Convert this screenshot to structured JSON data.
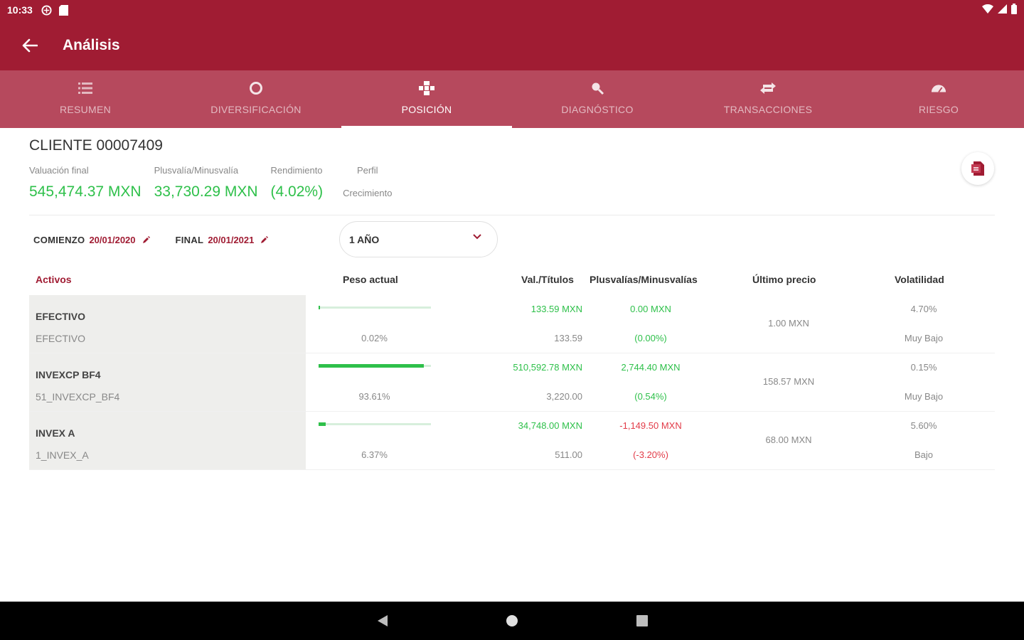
{
  "status_bar": {
    "time": "10:33"
  },
  "app_bar": {
    "title": "Análisis"
  },
  "tabs": [
    {
      "label": "RESUMEN",
      "icon": "list-icon"
    },
    {
      "label": "DIVERSIFICACIÓN",
      "icon": "donut-icon"
    },
    {
      "label": "POSICIÓN",
      "icon": "blocks-icon",
      "active": true
    },
    {
      "label": "DIAGNÓSTICO",
      "icon": "magnifier-icon"
    },
    {
      "label": "TRANSACCIONES",
      "icon": "exchange-icon"
    },
    {
      "label": "RIESGO",
      "icon": "gauge-icon"
    }
  ],
  "client": {
    "name": "CLIENTE 00007409",
    "valuation_label": "Valuación final",
    "valuation": "545,474.37 MXN",
    "gain_label": "Plusvalía/Minusvalía",
    "gain": "33,730.29 MXN",
    "return_label": "Rendimiento",
    "return": "(4.02%)",
    "profile_label": "Perfil",
    "profile": "Crecimiento"
  },
  "dates": {
    "start_label": "COMIENZO",
    "start": "20/01/2020",
    "end_label": "FINAL",
    "end": "20/01/2021",
    "period": "1 AÑO"
  },
  "table": {
    "headers": {
      "assets": "Activos",
      "weight": "Peso actual",
      "value": "Val./Títulos",
      "gain": "Plusvalías/Minusvalías",
      "last_price": "Último precio",
      "volatility": "Volatilidad"
    },
    "rows": [
      {
        "name": "EFECTIVO",
        "code": "EFECTIVO",
        "weight": "0.02%",
        "weight_fraction": 0.0002,
        "value": "133.59 MXN",
        "titles": "133.59",
        "gain": "0.00 MXN",
        "gain_pct": "(0.00%)",
        "gain_sign": "pos",
        "last_price": "1.00 MXN",
        "volatility": "4.70%",
        "vol_level": "Muy Bajo"
      },
      {
        "name": "INVEXCP BF4",
        "code": "51_INVEXCP_BF4",
        "weight": "93.61%",
        "weight_fraction": 0.9361,
        "value": "510,592.78 MXN",
        "titles": "3,220.00",
        "gain": "2,744.40 MXN",
        "gain_pct": "(0.54%)",
        "gain_sign": "pos",
        "last_price": "158.57 MXN",
        "volatility": "0.15%",
        "vol_level": "Muy Bajo"
      },
      {
        "name": "INVEX A",
        "code": "1_INVEX_A",
        "weight": "6.37%",
        "weight_fraction": 0.0637,
        "value": "34,748.00 MXN",
        "titles": "511.00",
        "gain": "-1,149.50 MXN",
        "gain_pct": "(-3.20%)",
        "gain_sign": "neg",
        "last_price": "68.00 MXN",
        "volatility": "5.60%",
        "vol_level": "Bajo"
      }
    ]
  },
  "colors": {
    "brand": "#a01c33",
    "tab_bar": "#b6495d",
    "positive": "#2ec04a",
    "negative": "#e23b48"
  }
}
